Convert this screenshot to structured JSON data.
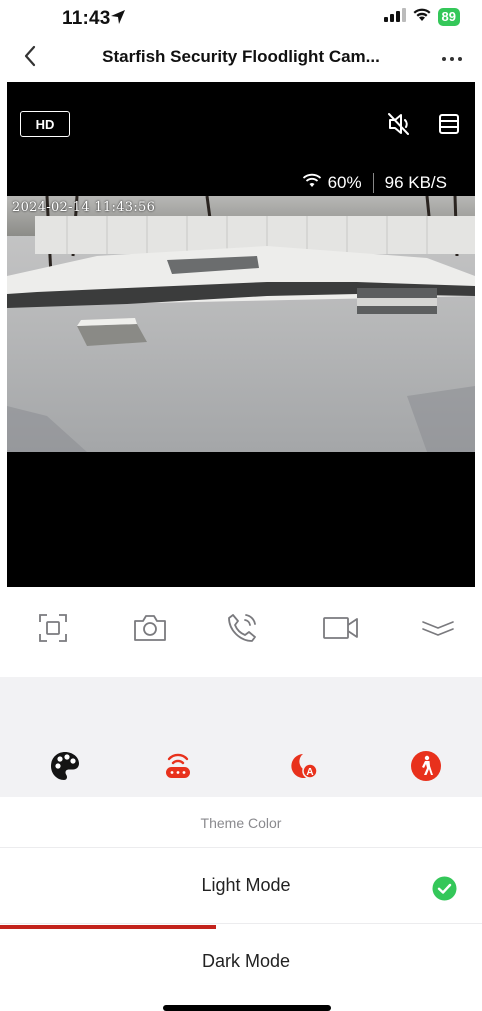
{
  "status_bar": {
    "time": "11:43",
    "battery": "89",
    "location_icon": "location-arrow-icon",
    "signal_icon": "cellular-signal-icon",
    "wifi_icon": "wifi-icon"
  },
  "nav": {
    "title": "Starfish Security Floodlight Cam...",
    "back_icon": "chevron-left-icon",
    "more_icon": "more-dots-icon"
  },
  "video": {
    "quality_label": "HD",
    "mute_icon": "speaker-muted-icon",
    "layout_icon": "split-layout-icon",
    "wifi_strength": "60%",
    "bitrate": "96 KB/S",
    "timestamp": "2024-02-14 11:43:56"
  },
  "toolbar": {
    "items": [
      "fullscreen-icon",
      "camera-icon",
      "phone-call-icon",
      "video-record-icon",
      "collapse-chevron-icon"
    ]
  },
  "features": {
    "items": [
      "palette-icon",
      "router-icon",
      "night-mode-auto-icon",
      "motion-person-icon"
    ],
    "accent_color": "#e8311c"
  },
  "sheet": {
    "title": "Theme Color",
    "options": [
      {
        "label": "Light Mode",
        "selected": true
      },
      {
        "label": "Dark Mode",
        "selected": false
      }
    ],
    "check_color": "#34c759"
  }
}
